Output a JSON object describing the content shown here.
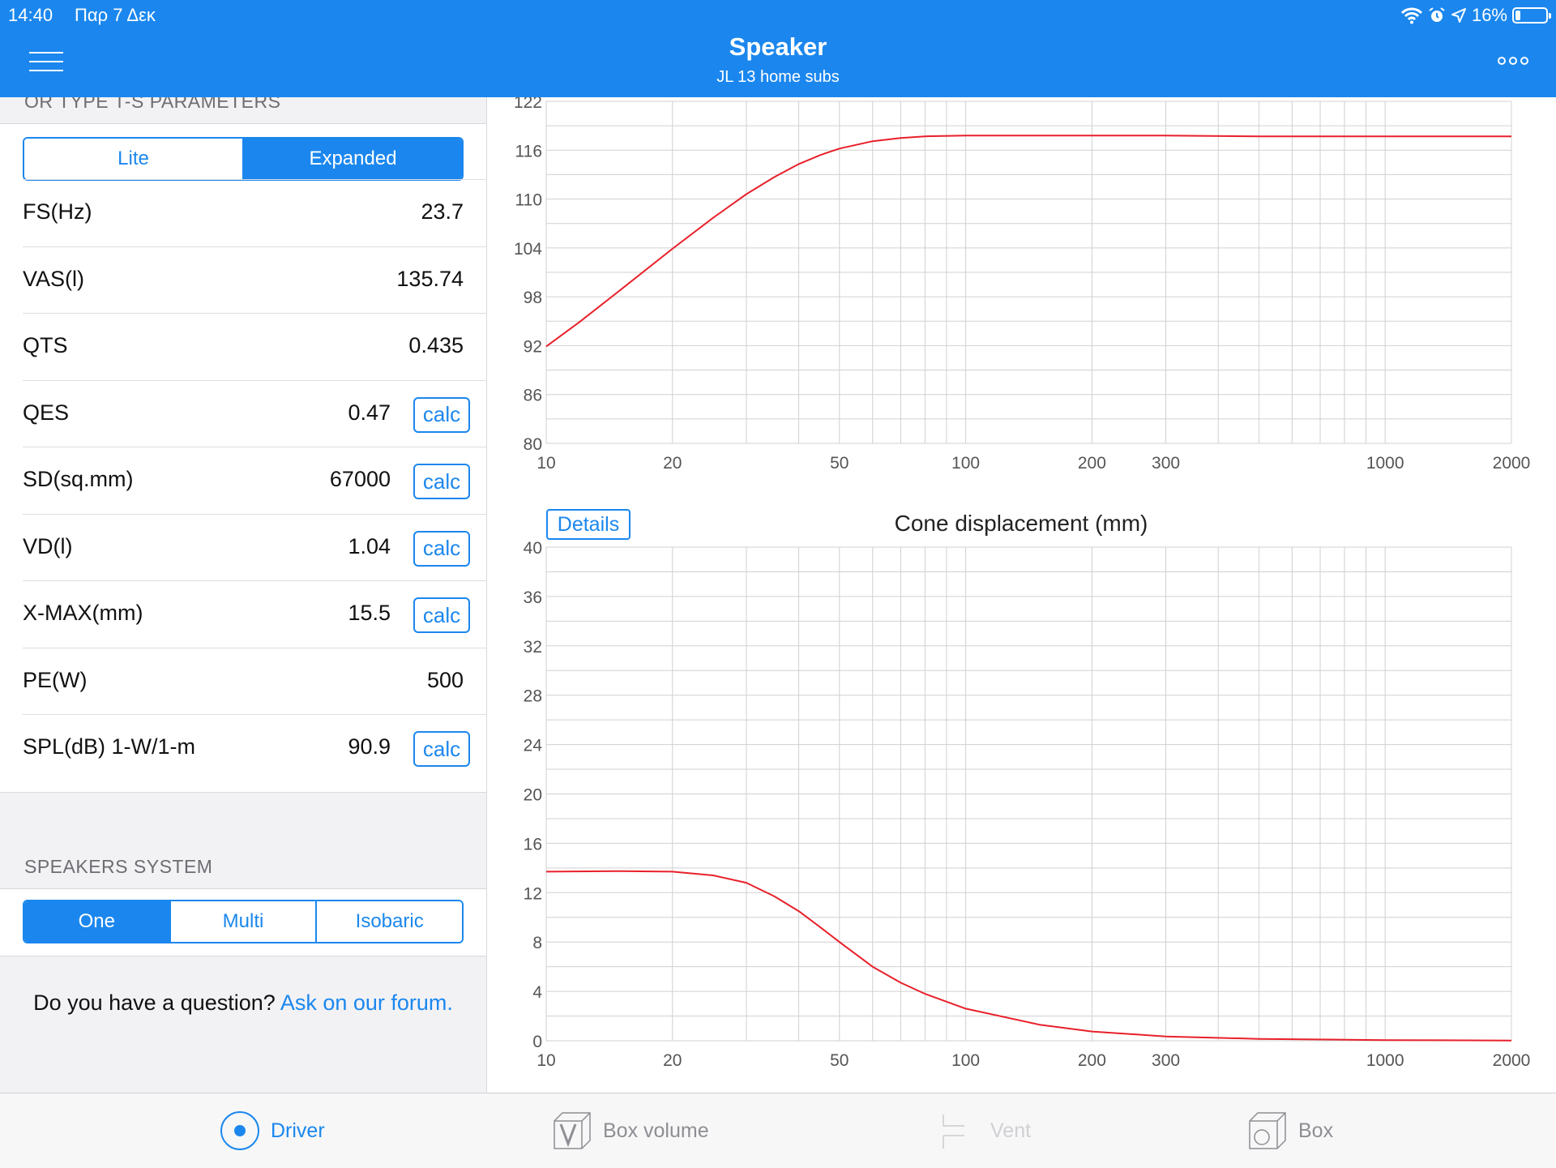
{
  "status": {
    "time": "14:40",
    "date": "Παρ 7 Δεκ",
    "battery": "16%",
    "battery_level": 0.16
  },
  "header": {
    "title": "Speaker",
    "subtitle": "JL 13 home subs"
  },
  "ts_section": {
    "header": "OR TYPE T-S PARAMETERS",
    "modes": [
      "Lite",
      "Expanded"
    ],
    "active_mode": "Expanded",
    "calc_label": "calc",
    "params": [
      {
        "label": "FS(Hz)",
        "value": "23.7",
        "calc": false
      },
      {
        "label": "VAS(l)",
        "value": "135.74",
        "calc": false
      },
      {
        "label": "QTS",
        "value": "0.435",
        "calc": false
      },
      {
        "label": "QES",
        "value": "0.47",
        "calc": true
      },
      {
        "label": "SD(sq.mm)",
        "value": "67000",
        "calc": true
      },
      {
        "label": "VD(l)",
        "value": "1.04",
        "calc": true
      },
      {
        "label": "X-MAX(mm)",
        "value": "15.5",
        "calc": true
      },
      {
        "label": "PE(W)",
        "value": "500",
        "calc": false
      },
      {
        "label": "SPL(dB) 1-W/1-m",
        "value": "90.9",
        "calc": true
      }
    ]
  },
  "system_section": {
    "header": "SPEAKERS SYSTEM",
    "options": [
      "One",
      "Multi",
      "Isobaric"
    ],
    "active": "One"
  },
  "question": {
    "text": "Do you have a question?",
    "link": "Ask on our forum."
  },
  "details_label": "Details",
  "tabs": [
    {
      "label": "Driver",
      "icon": "driver-radio-icon",
      "active": true
    },
    {
      "label": "Box volume",
      "icon": "box-volume-icon",
      "active": false
    },
    {
      "label": "Vent",
      "icon": "vent-icon",
      "active": false,
      "disabled": true
    },
    {
      "label": "Box",
      "icon": "box-icon",
      "active": false
    }
  ],
  "colors": {
    "accent": "#1b87ee",
    "curve": "#e8202a",
    "grid": "#d0d0d0"
  },
  "chart_data": [
    {
      "type": "line",
      "title": "",
      "xscale": "log",
      "xlim": [
        10,
        2000
      ],
      "ylim": [
        80,
        122
      ],
      "xticks": [
        10,
        20,
        50,
        100,
        200,
        300,
        1000,
        2000
      ],
      "yticks": [
        80,
        86,
        92,
        98,
        104,
        110,
        116,
        122
      ],
      "series": [
        {
          "x": [
            10,
            12,
            15,
            20,
            25,
            30,
            35,
            40,
            45,
            50,
            60,
            70,
            80,
            100,
            150,
            200,
            300,
            500,
            1000,
            2000
          ],
          "y": [
            91.9,
            94.9,
            98.8,
            103.9,
            107.7,
            110.6,
            112.7,
            114.3,
            115.4,
            116.2,
            117.1,
            117.5,
            117.7,
            117.8,
            117.8,
            117.8,
            117.8,
            117.7,
            117.7,
            117.7
          ]
        }
      ],
      "grid": true
    },
    {
      "type": "line",
      "title": "Cone displacement (mm)",
      "xscale": "log",
      "xlim": [
        10,
        2000
      ],
      "ylim": [
        0,
        40
      ],
      "xticks": [
        10,
        20,
        50,
        100,
        200,
        300,
        1000,
        2000
      ],
      "yticks": [
        0,
        4,
        8,
        12,
        16,
        20,
        24,
        28,
        32,
        36,
        40
      ],
      "series": [
        {
          "x": [
            10,
            15,
            20,
            25,
            30,
            35,
            40,
            45,
            50,
            60,
            70,
            80,
            100,
            150,
            200,
            300,
            500,
            1000,
            2000
          ],
          "y": [
            13.7,
            13.75,
            13.7,
            13.4,
            12.8,
            11.7,
            10.5,
            9.2,
            8.0,
            6.0,
            4.7,
            3.8,
            2.6,
            1.3,
            0.75,
            0.35,
            0.15,
            0.05,
            0.02
          ]
        }
      ],
      "grid": true
    }
  ]
}
